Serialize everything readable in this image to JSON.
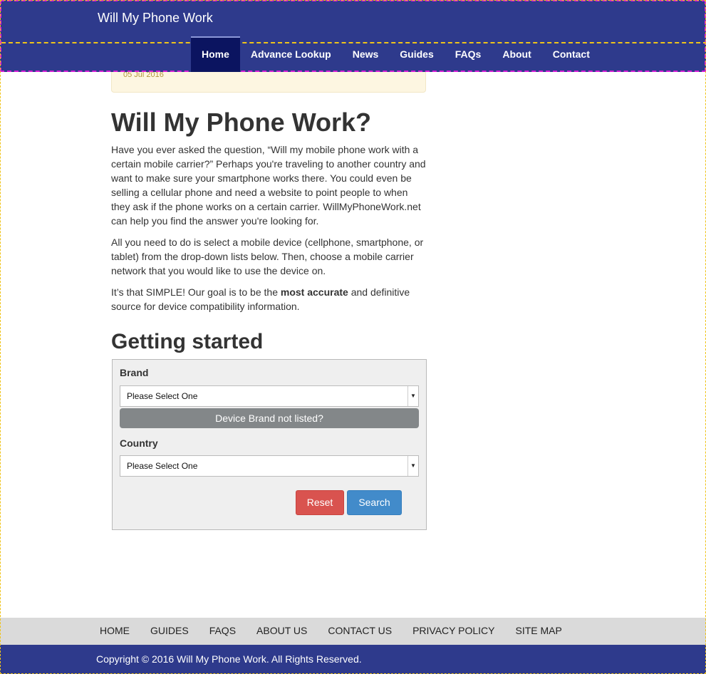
{
  "header": {
    "brand": "Will My Phone Work",
    "nav": [
      "Home",
      "Advance Lookup",
      "News",
      "Guides",
      "FAQs",
      "About",
      "Contact"
    ],
    "active_index": 0
  },
  "alert": {
    "date": "05 Jul 2016"
  },
  "intro": {
    "title": "Will My Phone Work?",
    "p1": "Have you ever asked the question, “Will my mobile phone work with a certain mobile carrier?” Perhaps you're traveling to another country and want to make sure your smartphone works there. You could even be selling a cellular phone and need a website to point people to when they ask if the phone works on a certain carrier. WillMyPhoneWork.net can help you find the answer you're looking for.",
    "p2": "All you need to do is select a mobile device (cellphone, smartphone, or tablet) from the drop-down lists below. Then, choose a mobile carrier network that you would like to use the device on.",
    "p3_before": "It’s that SIMPLE! Our goal is to be the ",
    "p3_bold": "most accurate",
    "p3_after": " and definitive source for device compatibility information."
  },
  "getting_started": {
    "heading": "Getting started",
    "brand_label": "Brand",
    "brand_value": "Please Select One",
    "brand_not_listed": "Device Brand not listed?",
    "country_label": "Country",
    "country_value": "Please Select One",
    "reset_label": "Reset",
    "search_label": "Search"
  },
  "footer": {
    "links": [
      "HOME",
      "GUIDES",
      "FAQS",
      "ABOUT US",
      "CONTACT US",
      "PRIVACY POLICY",
      "SITE MAP"
    ],
    "copyright": "Copyright © 2016 Will My Phone Work. All Rights Reserved."
  },
  "colors": {
    "header_bg": "#2e3a8c",
    "nav_active_bg": "#0b1460",
    "reset_btn": "#d9534f",
    "search_btn": "#428bca",
    "not_listed_btn": "#838789",
    "footer_links_bg": "#dadada"
  }
}
